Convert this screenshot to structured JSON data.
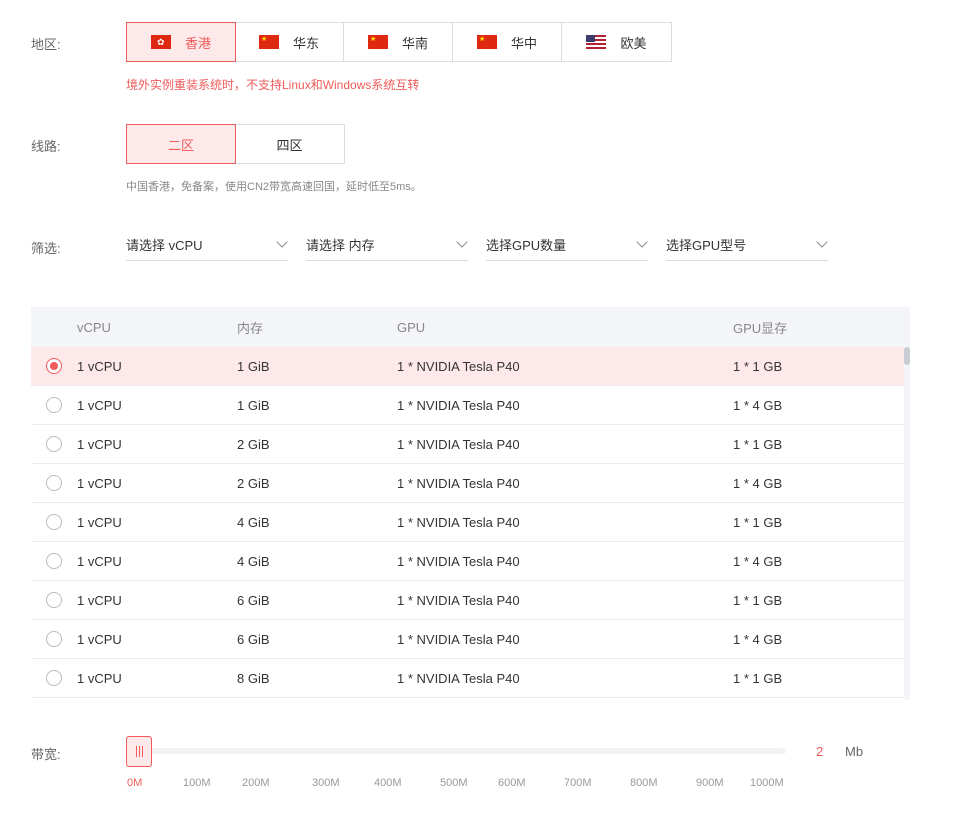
{
  "region": {
    "label": "地区:",
    "tabs": [
      {
        "label": "香港",
        "flag": "hk",
        "active": true
      },
      {
        "label": "华东",
        "flag": "cn",
        "active": false
      },
      {
        "label": "华南",
        "flag": "cn",
        "active": false
      },
      {
        "label": "华中",
        "flag": "cn",
        "active": false
      },
      {
        "label": "欧美",
        "flag": "us",
        "active": false
      }
    ],
    "warning": "境外实例重装系统时，不支持Linux和Windows系统互转"
  },
  "line": {
    "label": "线路:",
    "tabs": [
      {
        "label": "二区",
        "active": true
      },
      {
        "label": "四区",
        "active": false
      }
    ],
    "description": "中国香港，免备案，使用CN2带宽高速回国，延时低至5ms。"
  },
  "filter": {
    "label": "筛选:",
    "selects": [
      {
        "placeholder": "请选择 vCPU"
      },
      {
        "placeholder": "请选择 内存"
      },
      {
        "placeholder": "选择GPU数量"
      },
      {
        "placeholder": "选择GPU型号"
      }
    ]
  },
  "table": {
    "headers": {
      "cpu": "vCPU",
      "mem": "内存",
      "gpu": "GPU",
      "vram": "GPU显存"
    },
    "rows": [
      {
        "cpu": "1 vCPU",
        "mem": "1 GiB",
        "gpu": "1 * NVIDIA Tesla P40",
        "vram": "1 * 1 GB",
        "selected": true
      },
      {
        "cpu": "1 vCPU",
        "mem": "1 GiB",
        "gpu": "1 * NVIDIA Tesla P40",
        "vram": "1 * 4 GB",
        "selected": false
      },
      {
        "cpu": "1 vCPU",
        "mem": "2 GiB",
        "gpu": "1 * NVIDIA Tesla P40",
        "vram": "1 * 1 GB",
        "selected": false
      },
      {
        "cpu": "1 vCPU",
        "mem": "2 GiB",
        "gpu": "1 * NVIDIA Tesla P40",
        "vram": "1 * 4 GB",
        "selected": false
      },
      {
        "cpu": "1 vCPU",
        "mem": "4 GiB",
        "gpu": "1 * NVIDIA Tesla P40",
        "vram": "1 * 1 GB",
        "selected": false
      },
      {
        "cpu": "1 vCPU",
        "mem": "4 GiB",
        "gpu": "1 * NVIDIA Tesla P40",
        "vram": "1 * 4 GB",
        "selected": false
      },
      {
        "cpu": "1 vCPU",
        "mem": "6 GiB",
        "gpu": "1 * NVIDIA Tesla P40",
        "vram": "1 * 1 GB",
        "selected": false
      },
      {
        "cpu": "1 vCPU",
        "mem": "6 GiB",
        "gpu": "1 * NVIDIA Tesla P40",
        "vram": "1 * 4 GB",
        "selected": false
      },
      {
        "cpu": "1 vCPU",
        "mem": "8 GiB",
        "gpu": "1 * NVIDIA Tesla P40",
        "vram": "1 * 1 GB",
        "selected": false
      }
    ]
  },
  "bandwidth": {
    "label": "带宽:",
    "value": "2",
    "unit": "Mb",
    "ticks": [
      "0M",
      "100M",
      "200M",
      "300M",
      "400M",
      "500M",
      "600M",
      "700M",
      "800M",
      "900M",
      "1000M"
    ]
  },
  "colors": {
    "accent": "#f05a5a",
    "accent_bg": "#fde9e9"
  }
}
